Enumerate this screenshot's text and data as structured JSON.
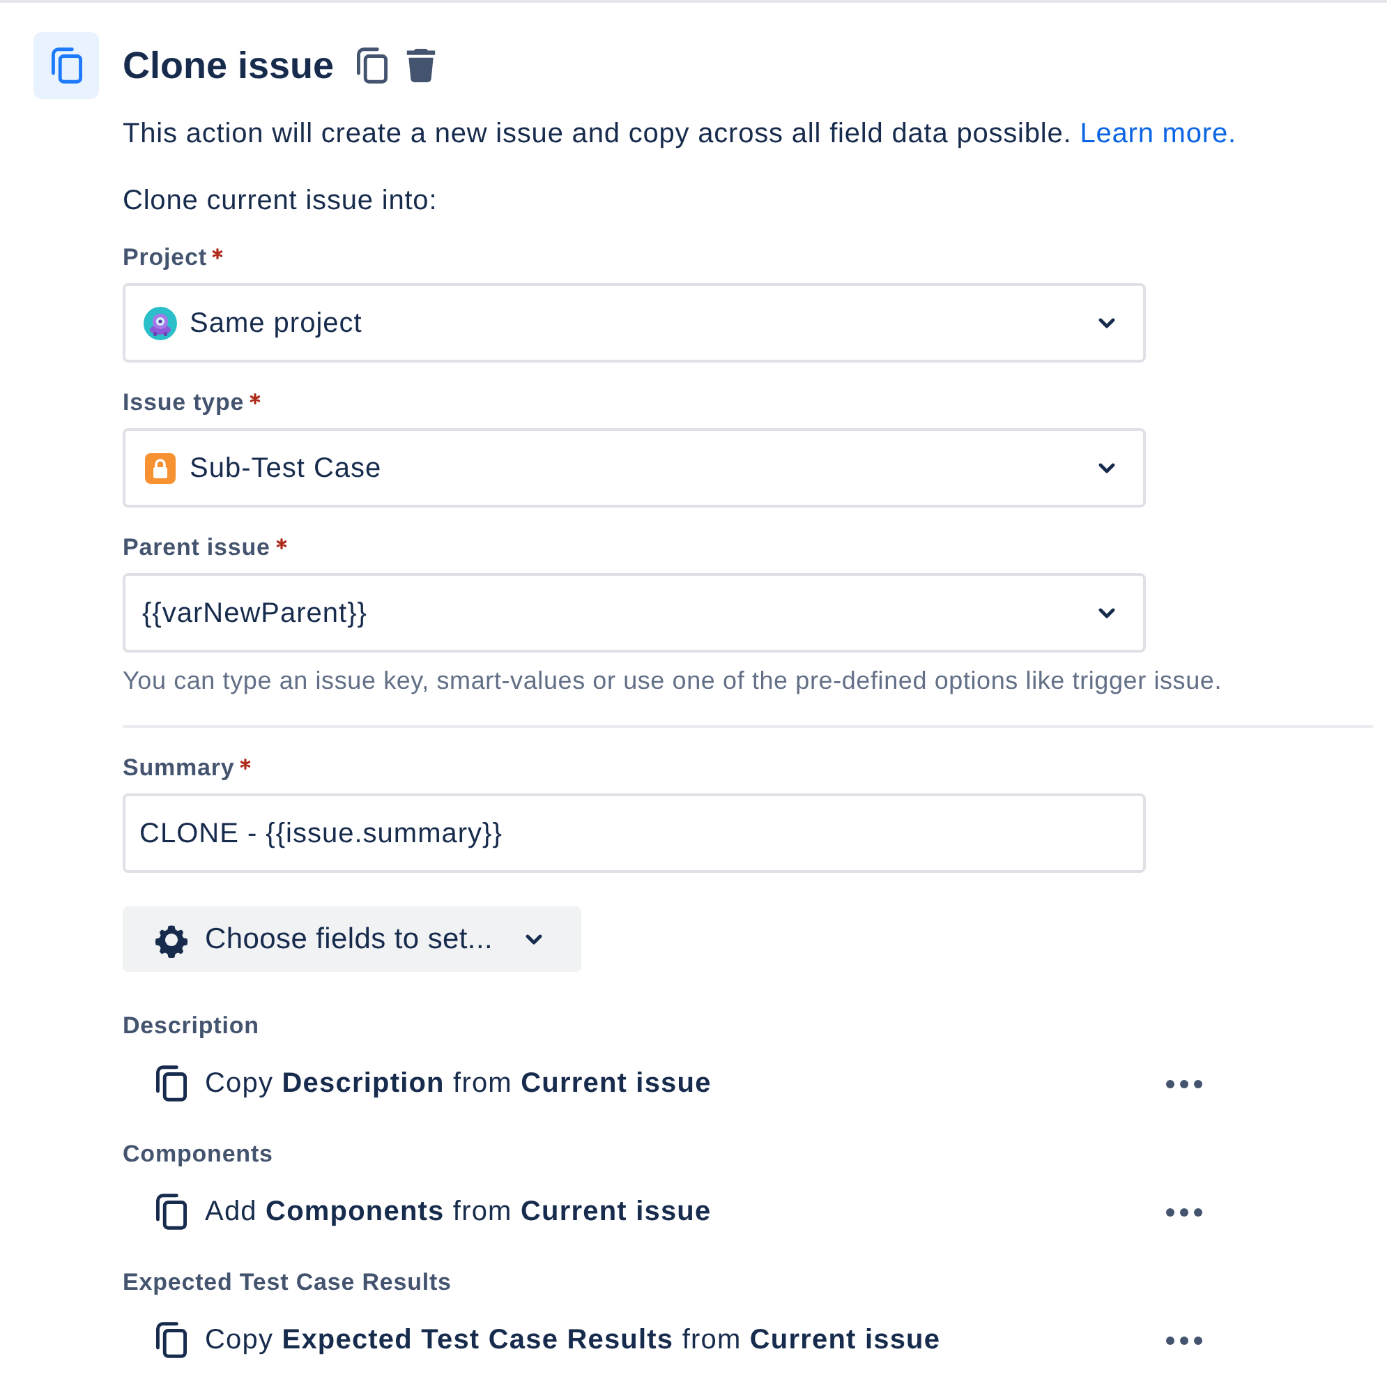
{
  "header": {
    "title": "Clone issue"
  },
  "intro": {
    "text": "This action will create a new issue and copy across all field data possible.",
    "link": "Learn more."
  },
  "target_heading": "Clone current issue into:",
  "target_fields": [
    {
      "kind": "project",
      "label": "Project",
      "required": true,
      "value": "Same project"
    },
    {
      "kind": "issuetype",
      "label": "Issue type",
      "required": true,
      "value": "Sub-Test Case"
    },
    {
      "kind": "select",
      "label": "Parent issue",
      "required": true,
      "value": "{{varNewParent}}",
      "helper": "You can type an issue key, smart-values or use one of the pre-defined options like trigger issue."
    }
  ],
  "summary": {
    "label": "Summary",
    "required": true,
    "value": "CLONE - {{issue.summary}}"
  },
  "choose_fields_button": {
    "label": "Choose fields to set..."
  },
  "field_actions": [
    {
      "label": "Description",
      "action": "Copy **Description** from **Current issue**"
    },
    {
      "label": "Components",
      "action": "Add **Components** from **Current issue**"
    },
    {
      "label": "Expected Test Case Results",
      "action": "Copy **Expected Test Case Results** from **Current issue**"
    }
  ]
}
